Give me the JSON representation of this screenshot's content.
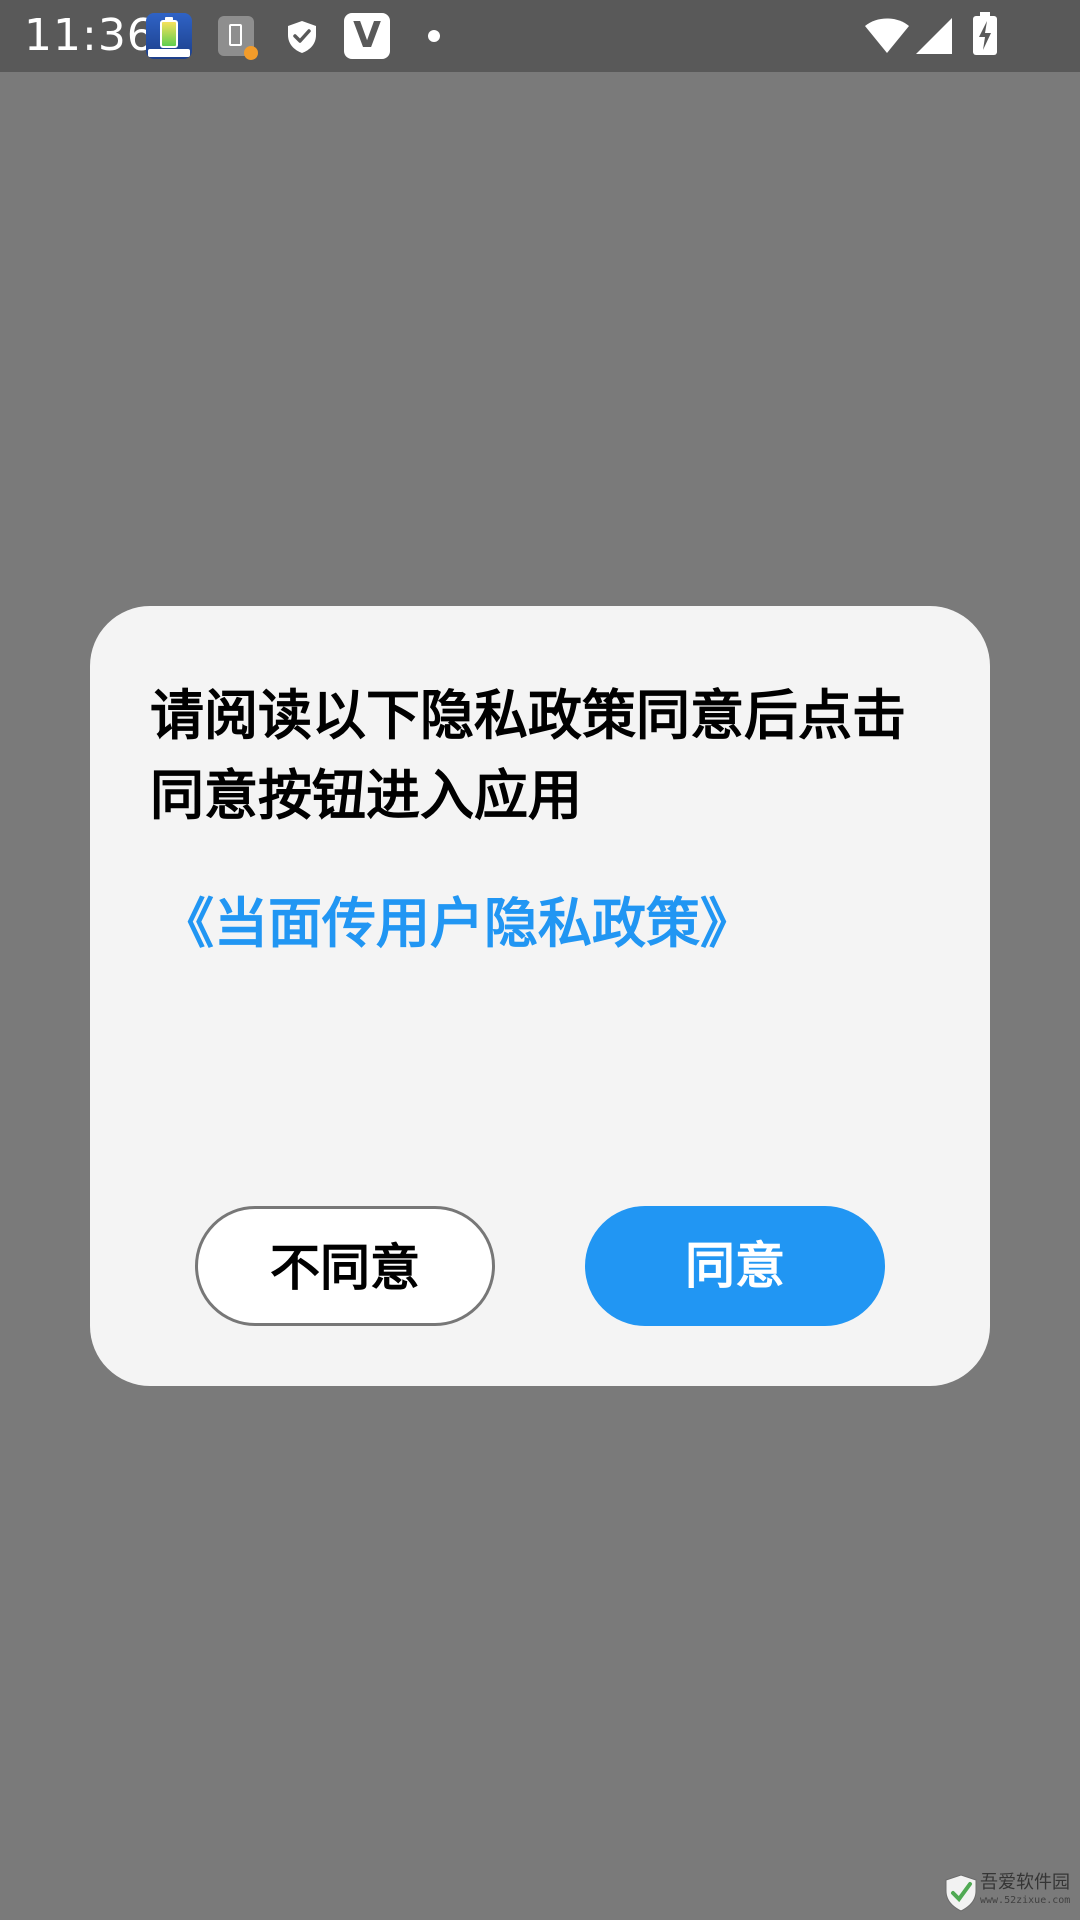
{
  "status_bar": {
    "time": "11:36",
    "icons": [
      "battery-app-icon",
      "battery-saver-icon",
      "shield-icon",
      "v-app-icon",
      "dot-icon",
      "wifi-icon",
      "signal-icon",
      "battery-charging-icon"
    ]
  },
  "dialog": {
    "title": "请阅读以下隐私政策同意后点击同意按钮进入应用",
    "policy_link": "《当面传用户隐私政策》",
    "disagree_label": "不同意",
    "agree_label": "同意"
  },
  "watermark": {
    "text": "吾爱软件园",
    "sub": "www.52zixue.com"
  },
  "colors": {
    "overlay": "#7a7a7a",
    "status_bar": "#595959",
    "dialog_bg": "#f4f4f4",
    "accent": "#2196f3"
  }
}
